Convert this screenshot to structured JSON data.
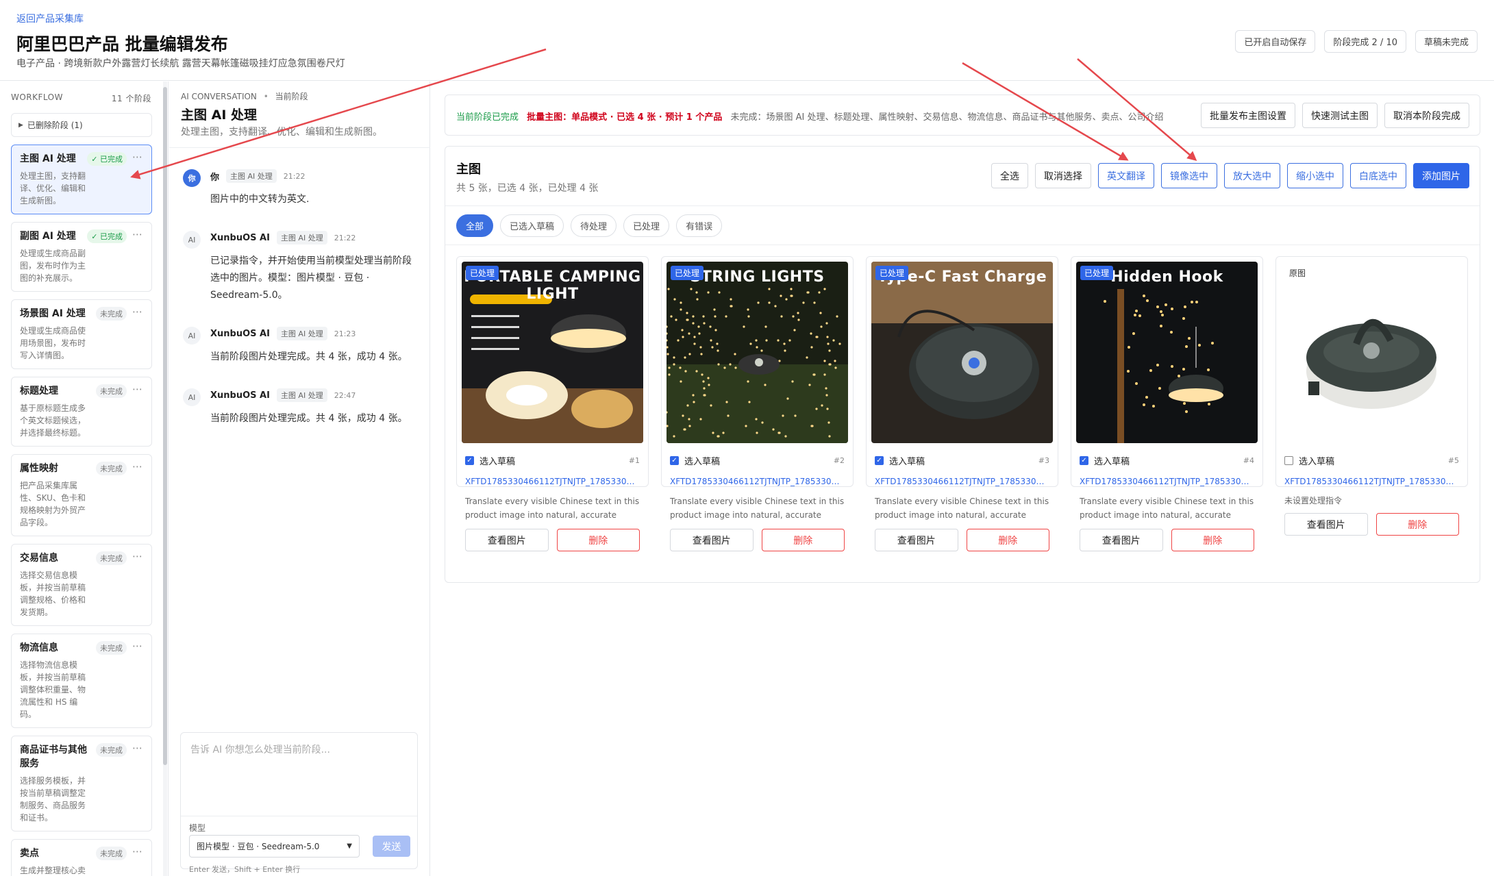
{
  "header": {
    "back_link": "返回产品采集库",
    "title": "阿里巴巴产品 批量编辑发布",
    "subtitle": "电子产品 · 跨境新款户外露营灯长续航 露营天幕帐篷磁吸挂灯应急氛围卷尺灯",
    "badges": [
      "已开启自动保存",
      "阶段完成 2 / 10",
      "草稿未完成"
    ]
  },
  "workflow": {
    "label": "WORKFLOW",
    "count": "11 个阶段",
    "deleted": "已删除阶段 (1)",
    "steps": [
      {
        "name": "主图 AI 处理",
        "status": "✓ 已完成",
        "done": true,
        "desc": "处理主图，支持翻译、优化、编辑和生成新图。"
      },
      {
        "name": "副图 AI 处理",
        "status": "✓ 已完成",
        "done": true,
        "desc": "处理或生成商品副图，发布时作为主图的补充展示。"
      },
      {
        "name": "场景图 AI 处理",
        "status": "未完成",
        "done": false,
        "desc": "处理或生成商品使用场景图，发布时写入详情图。"
      },
      {
        "name": "标题处理",
        "status": "未完成",
        "done": false,
        "desc": "基于原标题生成多个英文标题候选，并选择最终标题。"
      },
      {
        "name": "属性映射",
        "status": "未完成",
        "done": false,
        "desc": "把产品采集库属性、SKU、色卡和规格映射为外贸产品字段。"
      },
      {
        "name": "交易信息",
        "status": "未完成",
        "done": false,
        "desc": "选择交易信息模板，并按当前草稿调整规格、价格和发货期。"
      },
      {
        "name": "物流信息",
        "status": "未完成",
        "done": false,
        "desc": "选择物流信息模板，并按当前草稿调整体积重量、物流属性和 HS 编码。"
      },
      {
        "name": "商品证书与其他服务",
        "status": "未完成",
        "done": false,
        "desc": "选择服务模板，并按当前草稿调整定制服务、商品服务和证书。"
      },
      {
        "name": "卖点",
        "status": "未完成",
        "done": false,
        "desc": "生成并整理核心卖点、短描述和长描述。"
      }
    ]
  },
  "chat": {
    "kicker": "AI CONVERSATION",
    "kicker_sep": "•",
    "kicker_scope": "当前阶段",
    "title": "主图 AI 处理",
    "subtitle": "处理主图，支持翻译、优化、编辑和生成新图。",
    "messages": [
      {
        "avatar": "你",
        "author": "你",
        "tag": "主图 AI 处理",
        "time": "21:22",
        "text": "图片中的中文转为英文."
      },
      {
        "avatar": "AI",
        "author": "XunbuOS AI",
        "tag": "主图 AI 处理",
        "time": "21:22",
        "text": "已记录指令，并开始使用当前模型处理当前阶段选中的图片。模型：图片模型 · 豆包 · Seedream-5.0。"
      },
      {
        "avatar": "AI",
        "author": "XunbuOS AI",
        "tag": "主图 AI 处理",
        "time": "21:23",
        "text": "当前阶段图片处理完成。共 4 张，成功 4 张。"
      },
      {
        "avatar": "AI",
        "author": "XunbuOS AI",
        "tag": "主图 AI 处理",
        "time": "22:47",
        "text": "当前阶段图片处理完成。共 4 张，成功 4 张。"
      }
    ],
    "composer": {
      "placeholder": "告诉 AI 你想怎么处理当前阶段...",
      "model_label": "模型",
      "model_value": "图片模型 · 豆包 · Seedream-5.0",
      "send": "发送",
      "hint": "Enter 发送，Shift + Enter 换行"
    }
  },
  "stage_bar": {
    "done": "当前阶段已完成",
    "main_info": "批量主图：单品模式 · 已选 4 张 · 预计 1 个产品",
    "incomplete": "未完成：场景图 AI 处理、标题处理、属性映射、交易信息、物流信息、商品证书与其他服务、卖点、公司介绍",
    "actions": [
      "批量发布主图设置",
      "快速测试主图",
      "取消本阶段完成"
    ]
  },
  "panel": {
    "title": "主图",
    "subtitle": "共 5 张，已选 4 张，已处理 4 张",
    "actions": [
      {
        "label": "全选",
        "style": "default"
      },
      {
        "label": "取消选择",
        "style": "default"
      },
      {
        "label": "英文翻译",
        "style": "outline-blue"
      },
      {
        "label": "镜像选中",
        "style": "outline-blue"
      },
      {
        "label": "放大选中",
        "style": "outline-blue"
      },
      {
        "label": "缩小选中",
        "style": "outline-blue"
      },
      {
        "label": "白底选中",
        "style": "outline-blue"
      },
      {
        "label": "添加图片",
        "style": "primary"
      }
    ],
    "filters": [
      "全部",
      "已选入草稿",
      "待处理",
      "已处理",
      "有错误"
    ],
    "active_filter": 0,
    "cards": [
      {
        "tag": "已处理",
        "caption": "PORTABLE CAMPING LIGHT",
        "selected": true,
        "select_label": "选入草稿",
        "num": "#1",
        "file": "XFTD1785330466112TJTNJTP_1785330466112...",
        "desc": "Translate every visible Chinese text in this product image into natural, accurate English....",
        "view": "查看图片",
        "delete": "删除"
      },
      {
        "tag": "已处理",
        "caption": "STRING LIGHTS",
        "selected": true,
        "select_label": "选入草稿",
        "num": "#2",
        "file": "XFTD1785330466112TJTNJTP_1785330466112...",
        "desc": "Translate every visible Chinese text in this product image into natural, accurate English....",
        "view": "查看图片",
        "delete": "删除"
      },
      {
        "tag": "已处理",
        "caption": "Type-C Fast Charge",
        "selected": true,
        "select_label": "选入草稿",
        "num": "#3",
        "file": "XFTD1785330466112TJTNJTP_1785330466112F...",
        "desc": "Translate every visible Chinese text in this product image into natural, accurate English....",
        "view": "查看图片",
        "delete": "删除"
      },
      {
        "tag": "已处理",
        "caption": "Hidden Hook",
        "selected": true,
        "select_label": "选入草稿",
        "num": "#4",
        "file": "XFTD1785330466112TJTNJTP_1785330466112...",
        "desc": "Translate every visible Chinese text in this product image into natural, accurate English....",
        "view": "查看图片",
        "delete": "删除"
      },
      {
        "tag": "原图",
        "caption": "",
        "selected": false,
        "select_label": "选入草稿",
        "num": "#5",
        "file": "XFTD1785330466112TJTNJTP_1785330466112...",
        "note": "未设置处理指令",
        "view": "查看图片",
        "delete": "删除"
      }
    ]
  },
  "colors": {
    "accent": "#2f66e8",
    "success": "#1a9b48",
    "danger": "#ef4444",
    "annotation": "#e5484d"
  },
  "icons": {
    "deleted_toggle": "triangle-right-icon",
    "more": "more-dots-icon",
    "select_arrow": "chevron-down-icon",
    "check": "check-icon"
  }
}
